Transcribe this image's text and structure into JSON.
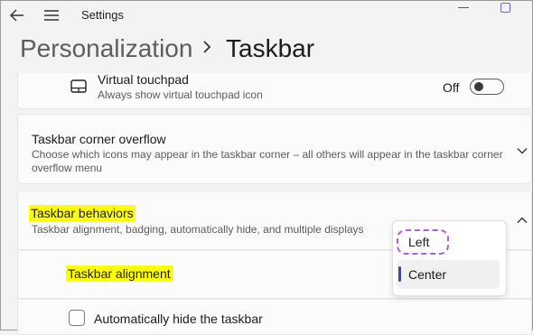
{
  "window": {
    "title": "Settings"
  },
  "breadcrumb": {
    "parent": "Personalization",
    "separator": ">",
    "current": "Taskbar"
  },
  "virtual_touchpad": {
    "title": "Virtual touchpad",
    "description": "Always show virtual touchpad icon",
    "state_label": "Off",
    "icon": "touchpad-icon"
  },
  "corner_overflow": {
    "title": "Taskbar corner overflow",
    "description_line1": "Choose which icons may appear in the taskbar corner – all others will appear in the taskbar corner",
    "description_line2": "overflow menu"
  },
  "behaviors": {
    "title": "Taskbar behaviors",
    "description": "Taskbar alignment, badging, automatically hide, and multiple displays"
  },
  "alignment": {
    "label": "Taskbar alignment",
    "options": [
      "Left",
      "Center"
    ],
    "selected": "Center"
  },
  "auto_hide": {
    "label": "Automatically hide the taskbar",
    "checked": false
  },
  "colors": {
    "highlight": "#ffff00",
    "accent": "#3b46b8",
    "annotation": "#b35ed6"
  }
}
